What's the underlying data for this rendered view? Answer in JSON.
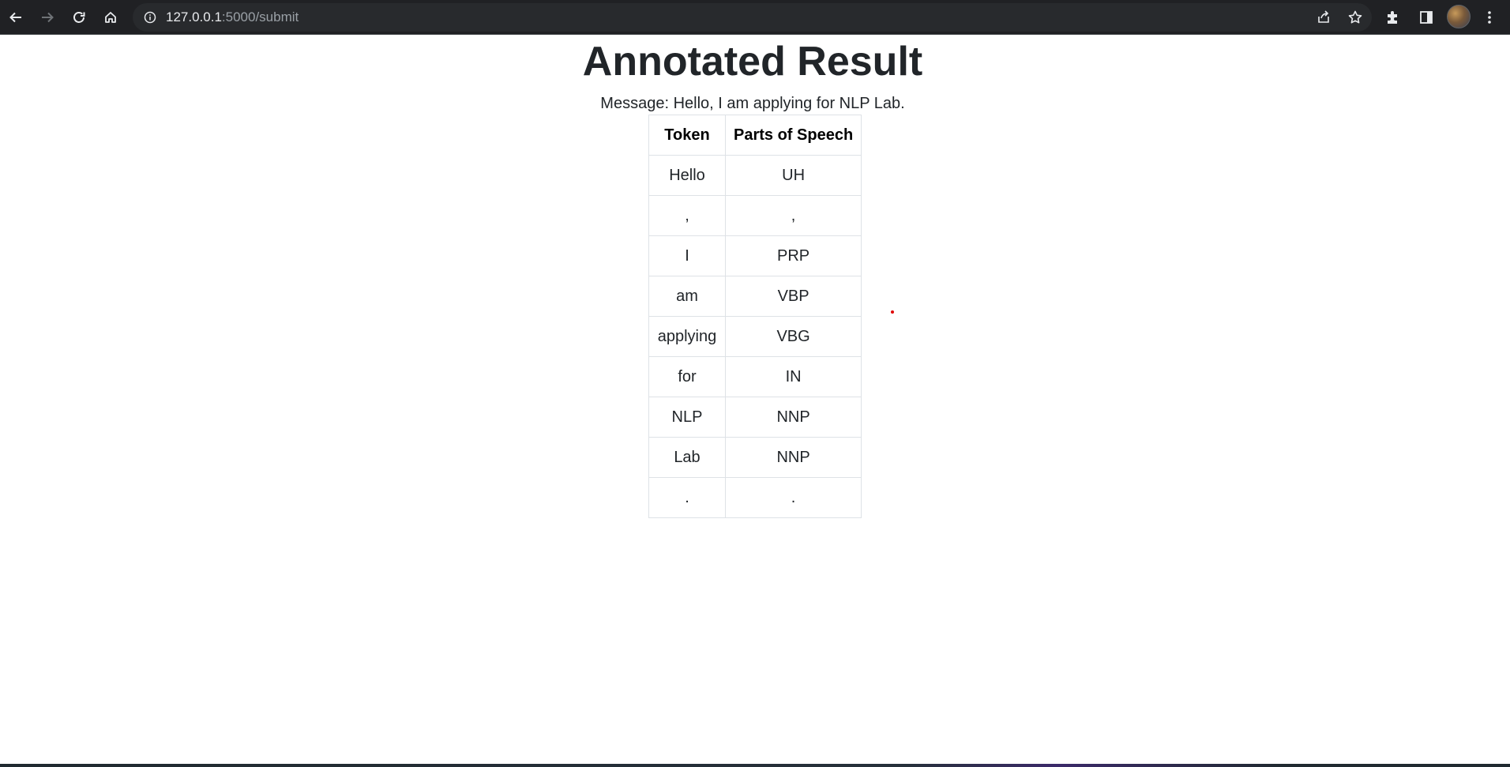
{
  "browser": {
    "url_host": "127.0.0.1",
    "url_path": ":5000/submit",
    "icons": {
      "back": "arrow-left-icon",
      "forward": "arrow-right-icon",
      "reload": "reload-icon",
      "home": "home-icon",
      "site_info": "info-icon",
      "share": "share-icon",
      "bookmark": "star-icon",
      "extensions": "puzzle-icon",
      "side_panel": "side-panel-icon",
      "menu": "kebab-menu-icon"
    }
  },
  "page": {
    "title": "Annotated Result",
    "message": "Message: Hello, I am applying for NLP Lab."
  },
  "table": {
    "headers": [
      "Token",
      "Parts of Speech"
    ],
    "rows": [
      [
        "Hello",
        "UH"
      ],
      [
        ",",
        ","
      ],
      [
        "I",
        "PRP"
      ],
      [
        "am",
        "VBP"
      ],
      [
        "applying",
        "VBG"
      ],
      [
        "for",
        "IN"
      ],
      [
        "NLP",
        "NNP"
      ],
      [
        "Lab",
        "NNP"
      ],
      [
        ".",
        "."
      ]
    ]
  },
  "colors": {
    "chrome_bg": "#202124",
    "omnibox_bg": "#282a2d",
    "text": "#212529",
    "table_border": "#dee2e6",
    "marker": "#e00000"
  }
}
